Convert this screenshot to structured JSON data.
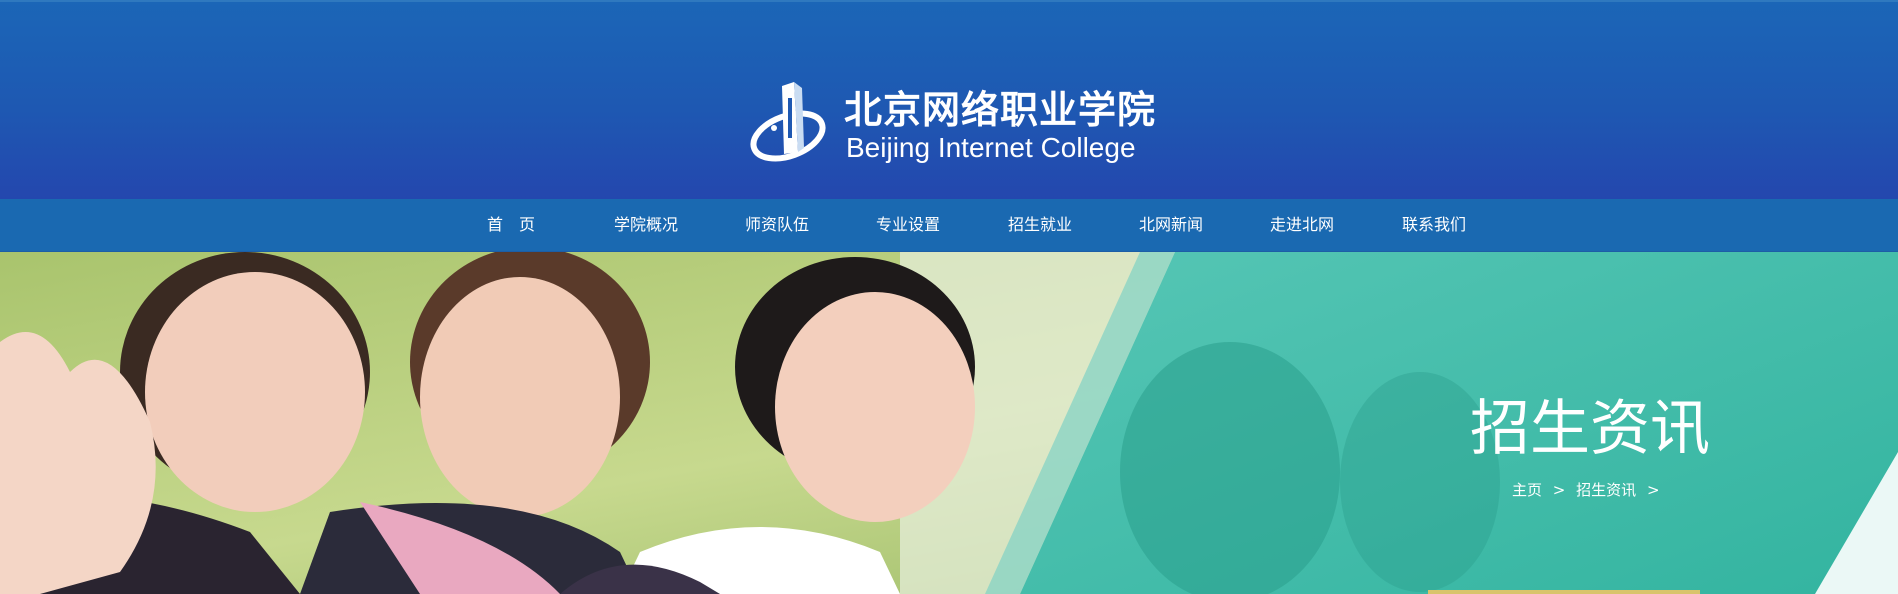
{
  "header": {
    "logo_cn": "北京网络职业学院",
    "logo_en": "Beijing Internet College"
  },
  "nav": {
    "items": [
      "首　页",
      "学院概况",
      "师资队伍",
      "专业设置",
      "招生就业",
      "北网新闻",
      "走进北网",
      "联系我们"
    ]
  },
  "banner": {
    "title": "招生资讯",
    "breadcrumb": {
      "home": "主页",
      "sep1": ">",
      "current": "招生资讯",
      "sep2": ">"
    }
  },
  "colors": {
    "header_top": "#1b66b7",
    "header_bottom": "#2447ae",
    "nav_bg": "#1a69b1",
    "banner_teal": "#3ebcaa",
    "accent_gold": "#d9c46c"
  }
}
